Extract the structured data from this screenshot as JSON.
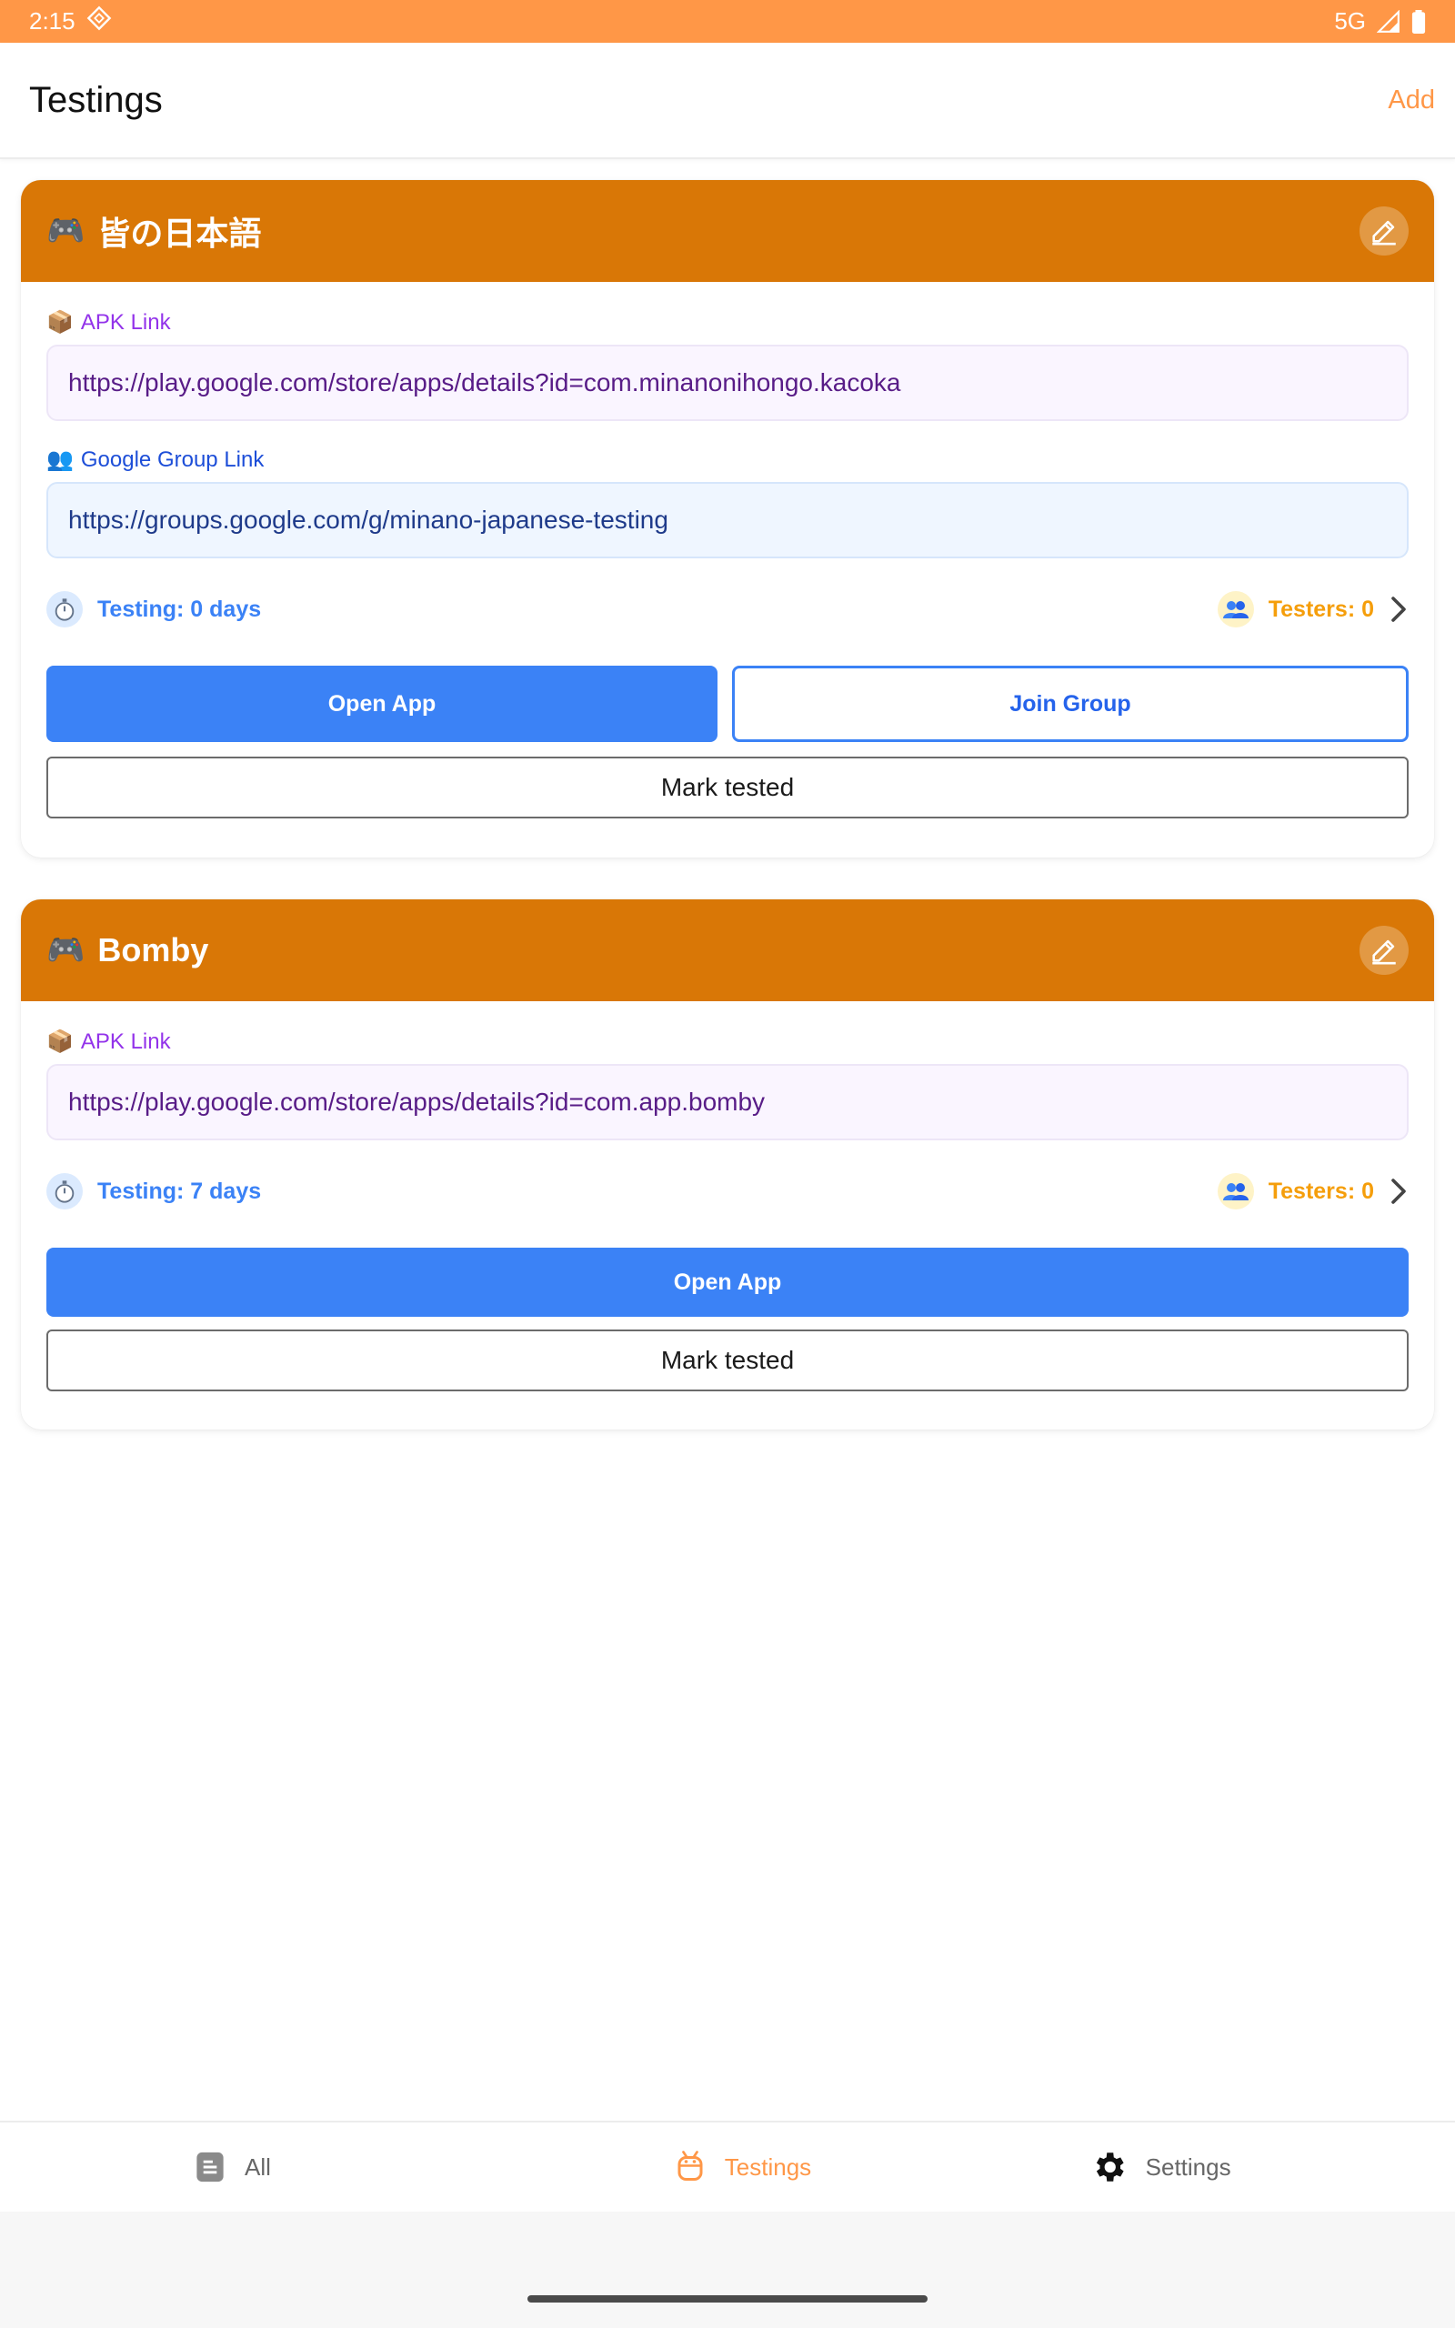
{
  "status_bar": {
    "time": "2:15",
    "network": "5G"
  },
  "app_bar": {
    "title": "Testings",
    "add_label": "Add"
  },
  "cards": [
    {
      "emoji": "🎮",
      "title": "皆の日本語",
      "apk_label": "APK Link",
      "apk_url": "https://play.google.com/store/apps/details?id=com.minanonihongo.kacoka",
      "group_label": "Google Group Link",
      "group_url": "https://groups.google.com/g/minano-japanese-testing",
      "testing_label": "Testing: 0 days",
      "testers_label": "Testers: 0",
      "open_label": "Open App",
      "join_label": "Join Group",
      "mark_label": "Mark tested"
    },
    {
      "emoji": "🎮",
      "title": "Bomby",
      "apk_label": "APK Link",
      "apk_url": "https://play.google.com/store/apps/details?id=com.app.bomby",
      "testing_label": "Testing: 7 days",
      "testers_label": "Testers: 0",
      "open_label": "Open App",
      "mark_label": "Mark tested"
    }
  ],
  "bottom_nav": [
    {
      "label": "All",
      "icon": "list-icon",
      "active": false
    },
    {
      "label": "Testings",
      "icon": "android-icon",
      "active": true
    },
    {
      "label": "Settings",
      "icon": "gear-icon",
      "active": false
    }
  ],
  "colors": {
    "accent": "#ff9747",
    "card_header": "#d97706",
    "primary_button": "#3b82f6",
    "apk_label": "#9333ea",
    "group_label": "#1d4ed8",
    "testers": "#f59e0b"
  }
}
